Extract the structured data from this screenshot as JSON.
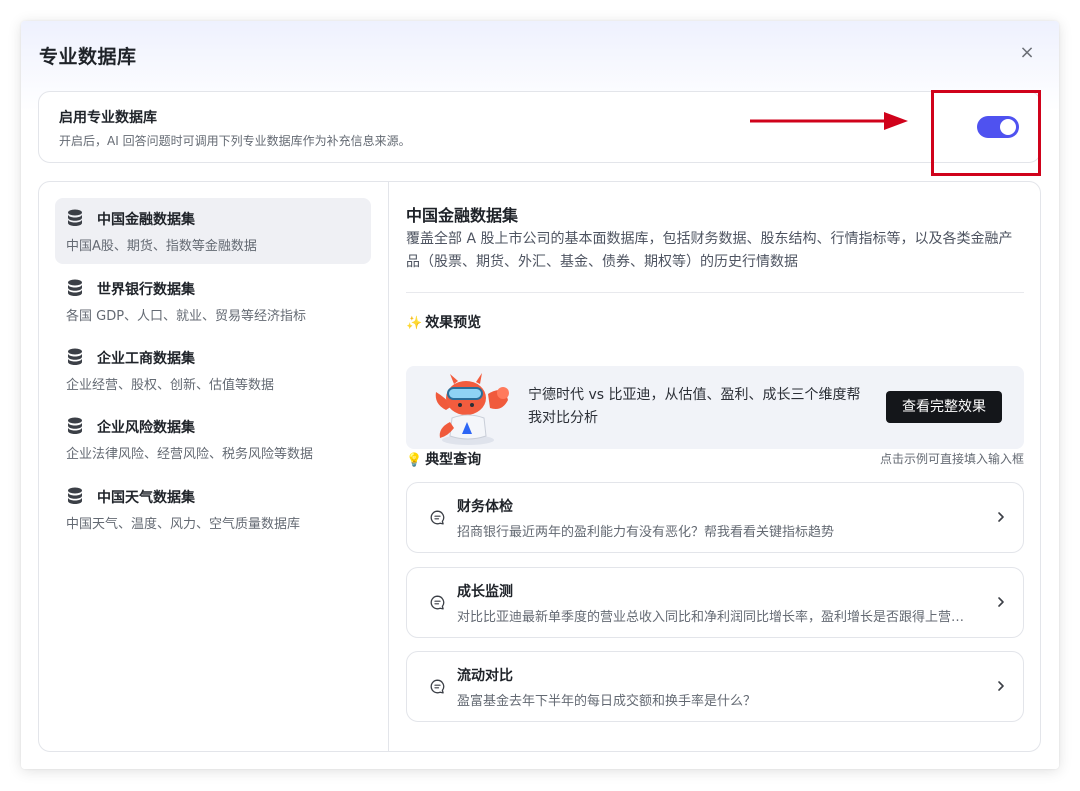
{
  "modal": {
    "title": "专业数据库",
    "close_glyph": "×"
  },
  "enable": {
    "title": "启用专业数据库",
    "description": "开启后，AI 回答问题时可调用下列专业数据库作为补充信息来源。",
    "toggle_on": true
  },
  "colors": {
    "accent": "#4f52f0",
    "annotation": "#d0021b",
    "button_dark": "#14161a"
  },
  "datasets": [
    {
      "name": "中国金融数据集",
      "desc": "中国A股、期货、指数等金融数据",
      "icon": "database-icon",
      "active": true
    },
    {
      "name": "世界银行数据集",
      "desc": "各国 GDP、人口、就业、贸易等经济指标",
      "icon": "database-icon",
      "active": false
    },
    {
      "name": "企业工商数据集",
      "desc": "企业经营、股权、创新、估值等数据",
      "icon": "database-icon",
      "active": false
    },
    {
      "name": "企业风险数据集",
      "desc": "企业法律风险、经营风险、税务风险等数据",
      "icon": "database-icon",
      "active": false
    },
    {
      "name": "中国天气数据集",
      "desc": "中国天气、温度、风力、空气质量数据库",
      "icon": "database-icon",
      "active": false
    }
  ],
  "detail": {
    "title": "中国金融数据集",
    "description": "覆盖全部 A 股上市公司的基本面数据库，包括财务数据、股东结构、行情指标等，以及各类金融产品（股票、期货、外汇、基金、债券、期权等）的历史行情数据",
    "preview": {
      "emoji": "✨",
      "title": "效果预览",
      "text": "宁德时代 vs 比亚迪，从估值、盈利、成长三个维度帮我对比分析",
      "button": "查看完整效果"
    },
    "queries_section": {
      "emoji": "💡",
      "title": "典型查询",
      "hint": "点击示例可直接填入输入框"
    },
    "queries": [
      {
        "title": "财务体检",
        "text": "招商银行最近两年的盈利能力有没有恶化？帮我看看关键指标趋势"
      },
      {
        "title": "成长监测",
        "text": "对比比亚迪最新单季度的营业总收入同比和净利润同比增长率，盈利增长是否跟得上营收增长？"
      },
      {
        "title": "流动对比",
        "text": "盈富基金去年下半年的每日成交额和换手率是什么？"
      }
    ]
  }
}
